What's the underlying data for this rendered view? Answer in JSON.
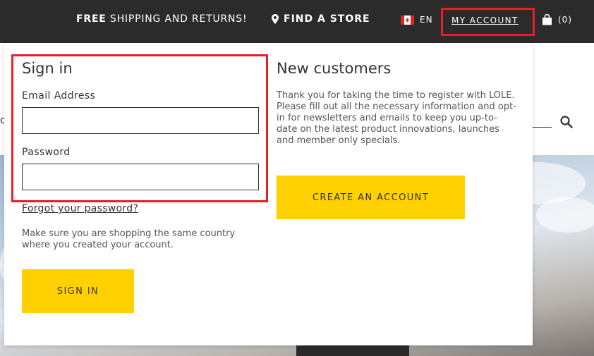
{
  "topbar": {
    "promo_bold": "FREE",
    "promo_rest": " SHIPPING AND RETURNS!",
    "store_label": "FIND A STORE",
    "language": "EN",
    "account_label": "MY ACCOUNT",
    "cart_count": "(0)"
  },
  "signin": {
    "heading": "Sign in",
    "email_label": "Email Address",
    "email_value": "",
    "password_label": "Password",
    "password_value": "",
    "forgot_link": "Forgot your password?",
    "note": "Make sure you are shopping the same country where you created your account.",
    "button": "SIGN IN"
  },
  "new_customers": {
    "heading": "New customers",
    "text": "Thank you for taking the time to register with LOLE. Please fill out all the necessary information and opt-in for newsletters and emails to keep you up-to-date on the latest product innovations, launches and member only specials.",
    "button": "CREATE AN ACCOUNT"
  },
  "colors": {
    "topbar": "#2b2b2b",
    "accent_yellow": "#ffd100",
    "highlight_red": "#e2212a"
  },
  "icons": [
    "map-pin-icon",
    "canada-flag-icon",
    "shopping-bag-icon",
    "search-icon"
  ]
}
